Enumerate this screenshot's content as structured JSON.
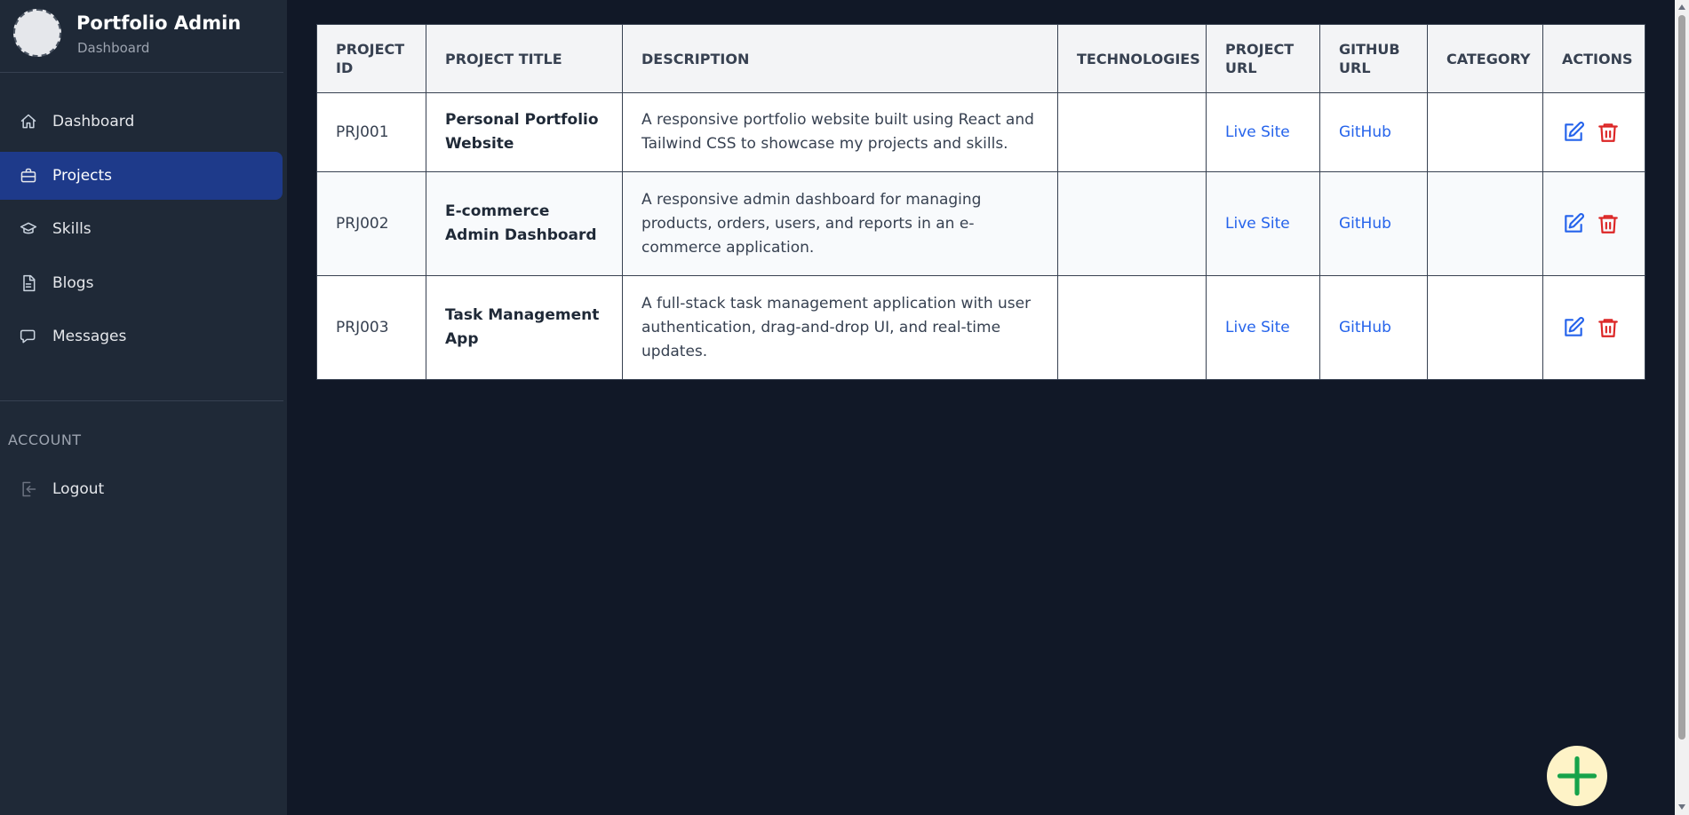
{
  "brand": {
    "title": "Portfolio Admin",
    "subtitle": "Dashboard"
  },
  "sidebar": {
    "items": [
      {
        "label": "Dashboard",
        "icon": "home-icon",
        "active": false
      },
      {
        "label": "Projects",
        "icon": "briefcase-icon",
        "active": true
      },
      {
        "label": "Skills",
        "icon": "graduation-cap-icon",
        "active": false
      },
      {
        "label": "Blogs",
        "icon": "document-icon",
        "active": false
      },
      {
        "label": "Messages",
        "icon": "chat-icon",
        "active": false
      }
    ],
    "account_section": "ACCOUNT",
    "logout": {
      "label": "Logout",
      "icon": "logout-icon"
    }
  },
  "table": {
    "headers": [
      "PROJECT ID",
      "PROJECT TITLE",
      "DESCRIPTION",
      "TECHNOLOGIES",
      "PROJECT URL",
      "GITHUB URL",
      "CATEGORY",
      "ACTIONS"
    ],
    "rows": [
      {
        "id": "PRJ001",
        "title": "Personal Portfolio Website",
        "description": "A responsive portfolio website built using React and Tailwind CSS to showcase my projects and skills.",
        "technologies": "",
        "project_url": "Live Site",
        "github_url": "GitHub",
        "category": ""
      },
      {
        "id": "PRJ002",
        "title": "E-commerce Admin Dashboard",
        "description": "A responsive admin dashboard for managing products, orders, users, and reports in an e-commerce application.",
        "technologies": "",
        "project_url": "Live Site",
        "github_url": "GitHub",
        "category": ""
      },
      {
        "id": "PRJ003",
        "title": "Task Management App",
        "description": "A full-stack task management application with user authentication, drag-and-drop UI, and real-time updates.",
        "technologies": "",
        "project_url": "Live Site",
        "github_url": "GitHub",
        "category": ""
      }
    ]
  },
  "colors": {
    "page_bg": "#111827",
    "sidebar_bg": "#1f2937",
    "active_bg": "#1e3a8a",
    "link": "#2563eb",
    "edit_icon": "#2563eb",
    "delete_icon": "#dc2626",
    "fab_bg": "#fef3c7",
    "fab_icon": "#16a34a"
  },
  "fab": {
    "icon": "plus-icon"
  }
}
